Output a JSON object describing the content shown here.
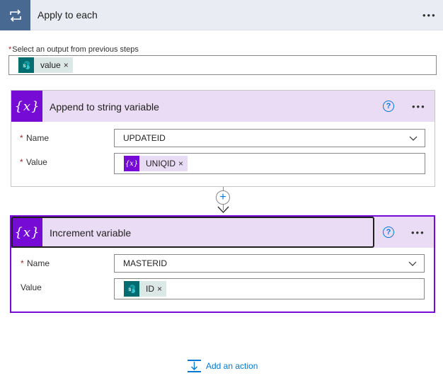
{
  "loop": {
    "title": "Apply to each",
    "more_label": "•••",
    "select_label": "Select an output from previous steps",
    "required_mark": "*",
    "token": {
      "label": "value",
      "remove": "×"
    }
  },
  "append_card": {
    "title": "Append to string variable",
    "help": "?",
    "more_label": "•••",
    "name_label": "Name",
    "name_value": "UPDATEID",
    "value_label": "Value",
    "value_token": {
      "label": "UNIQID",
      "remove": "×"
    },
    "required_mark": "*"
  },
  "increment_card": {
    "title": "Increment variable",
    "help": "?",
    "more_label": "•••",
    "name_label": "Name",
    "name_value": "MASTERID",
    "value_label": "Value",
    "value_token": {
      "label": "ID",
      "remove": "×"
    },
    "required_mark": "*"
  },
  "add_action": {
    "label": "Add an action"
  },
  "icons": {
    "loop": "loop-icon",
    "variable": "variable-icon",
    "sharepoint": "sharepoint-icon",
    "help": "help-icon",
    "chevron": "chevron-down-icon",
    "plus": "plus-icon",
    "add_action": "add-action-icon"
  },
  "colors": {
    "loop_accent": "#486991",
    "variable_accent": "#770bd6",
    "sharepoint_accent": "#036c70",
    "link": "#0078d4"
  }
}
